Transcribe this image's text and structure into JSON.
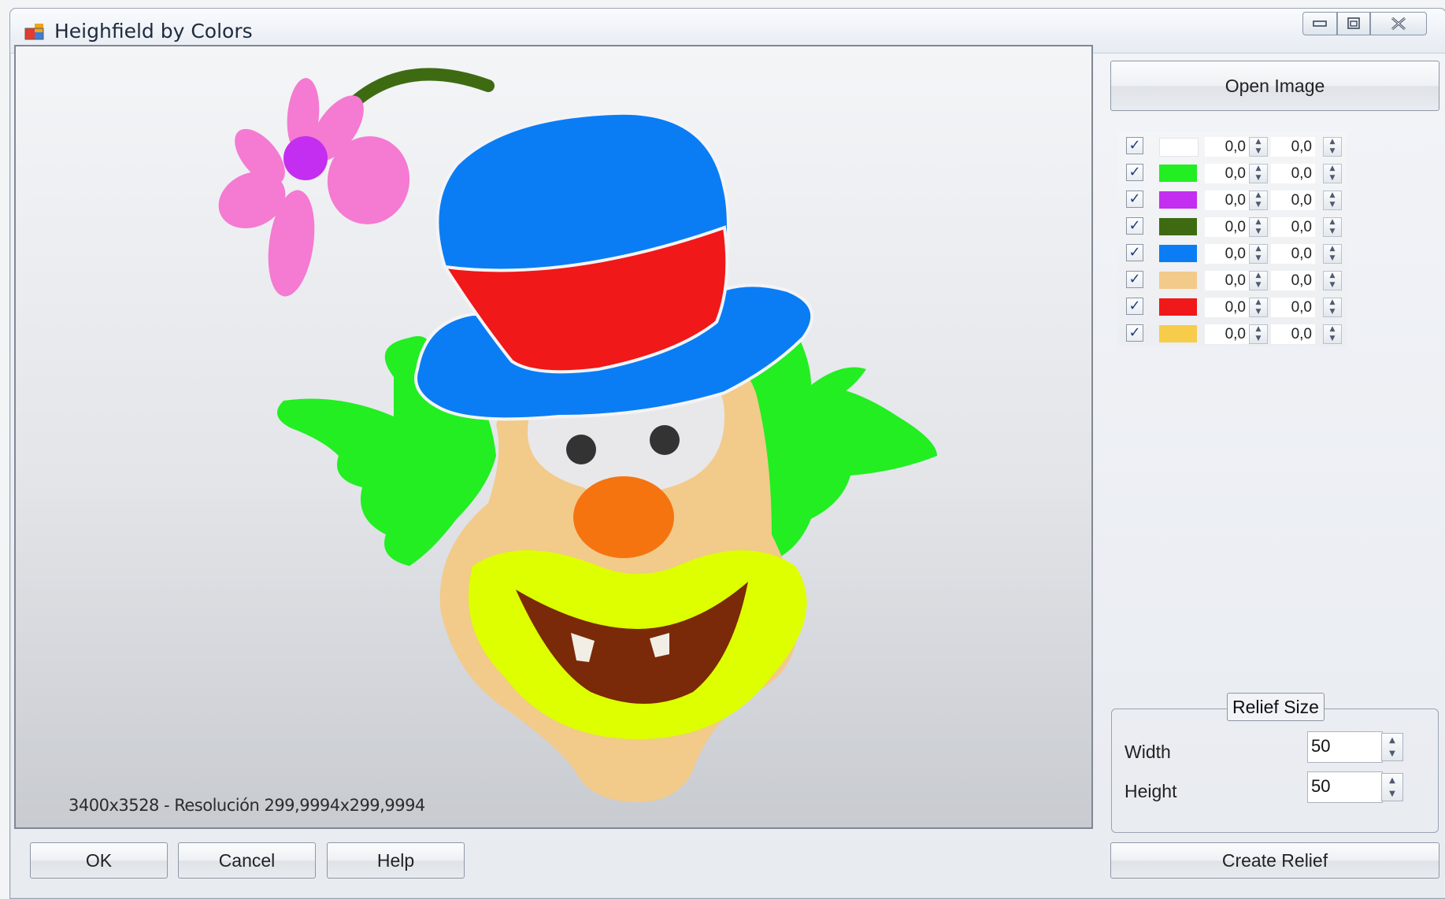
{
  "window": {
    "title": "Heighfield by Colors"
  },
  "canvas": {
    "image_info": "3400x3528 - Resolución 299,9994x299,9994"
  },
  "buttons": {
    "open_image": "Open Image",
    "ok": "OK",
    "cancel": "Cancel",
    "help": "Help",
    "create_relief": "Create Relief"
  },
  "colors": [
    {
      "checked": true,
      "swatch": "#ffffff",
      "value1": "0,0",
      "value2": "0,0"
    },
    {
      "checked": true,
      "swatch": "#22ee22",
      "value1": "0,0",
      "value2": "0,0"
    },
    {
      "checked": true,
      "swatch": "#c42ef0",
      "value1": "0,0",
      "value2": "0,0"
    },
    {
      "checked": true,
      "swatch": "#3e6b12",
      "value1": "0,0",
      "value2": "0,0"
    },
    {
      "checked": true,
      "swatch": "#0a7df5",
      "value1": "0,0",
      "value2": "0,0"
    },
    {
      "checked": true,
      "swatch": "#f2ca8a",
      "value1": "0,0",
      "value2": "0,0"
    },
    {
      "checked": true,
      "swatch": "#f01818",
      "value1": "0,0",
      "value2": "0,0"
    },
    {
      "checked": true,
      "swatch": "#f7cc4a",
      "value1": "0,0",
      "value2": "0,0"
    }
  ],
  "relief_size": {
    "legend": "Relief Size",
    "width_label": "Width",
    "width_value": "50",
    "height_label": "Height",
    "height_value": "50"
  },
  "clown_palette": {
    "hat": "#0a7df5",
    "hat_band": "#f01818",
    "hair": "#22ee22",
    "face": "#f2ca8a",
    "mouth_ring": "#ddff00",
    "mouth": "#7a2a08",
    "nose": "#f57410",
    "petals": "#f57ad2",
    "flower_center": "#c42ef0",
    "stem": "#3e6b12",
    "eyes_white": "#e8e8ea",
    "pupils": "#333333"
  }
}
